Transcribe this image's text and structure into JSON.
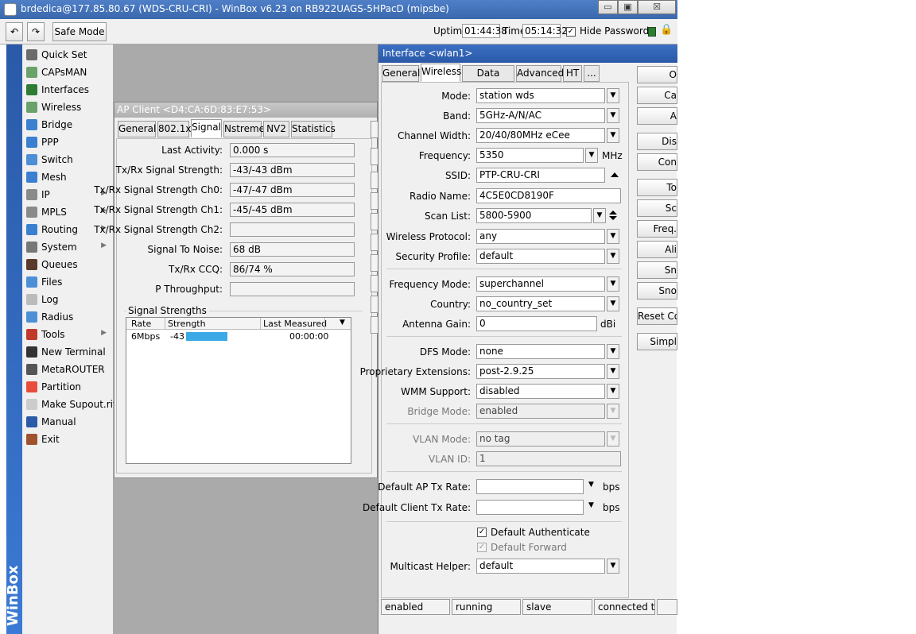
{
  "window": {
    "title": "brdedica@177.85.80.67 (WDS-CRU-CRI) - WinBox v6.23 on RB922UAGS-5HPacD (mipsbe)",
    "minimize_glyph": "▭",
    "maximize_glyph": "▣",
    "close_glyph": "☒"
  },
  "toolbar": {
    "undo_glyph": "↶",
    "redo_glyph": "↷",
    "safe_mode": "Safe Mode",
    "uptime_label": "Uptime:",
    "uptime": "01:44:38",
    "time_label": "Time:",
    "time": "05:14:32",
    "hide_passwords_check": "✓",
    "hide_passwords": "Hide Passwords",
    "lock_glyph": "🔒"
  },
  "brand": "WinBox",
  "sidebar": {
    "items": [
      {
        "label": "Quick Set",
        "icon": "wand-icon",
        "color": "#6b6b6b",
        "arrow": ""
      },
      {
        "label": "CAPsMAN",
        "icon": "antenna-icon",
        "color": "#6aa36a",
        "arrow": ""
      },
      {
        "label": "Interfaces",
        "icon": "interfaces-icon",
        "color": "#2e7d32",
        "arrow": ""
      },
      {
        "label": "Wireless",
        "icon": "wireless-icon",
        "color": "#6aa36a",
        "arrow": ""
      },
      {
        "label": "Bridge",
        "icon": "bridge-icon",
        "color": "#3a7fd0",
        "arrow": ""
      },
      {
        "label": "PPP",
        "icon": "ppp-icon",
        "color": "#3a7fd0",
        "arrow": ""
      },
      {
        "label": "Switch",
        "icon": "switch-icon",
        "color": "#4c8fd6",
        "arrow": ""
      },
      {
        "label": "Mesh",
        "icon": "mesh-icon",
        "color": "#3a7fd0",
        "arrow": ""
      },
      {
        "label": "IP",
        "icon": "ip-icon",
        "color": "#8a8a8a",
        "arrow": "▶"
      },
      {
        "label": "MPLS",
        "icon": "mpls-icon",
        "color": "#8a8a8a",
        "arrow": "▶"
      },
      {
        "label": "Routing",
        "icon": "routing-icon",
        "color": "#3a7fd0",
        "arrow": "▶"
      },
      {
        "label": "System",
        "icon": "gear-icon",
        "color": "#777777",
        "arrow": "▶"
      },
      {
        "label": "Queues",
        "icon": "queues-icon",
        "color": "#5a3a2a",
        "arrow": ""
      },
      {
        "label": "Files",
        "icon": "folder-icon",
        "color": "#4c8fd6",
        "arrow": ""
      },
      {
        "label": "Log",
        "icon": "log-icon",
        "color": "#bbbbbb",
        "arrow": ""
      },
      {
        "label": "Radius",
        "icon": "radius-icon",
        "color": "#4c8fd6",
        "arrow": ""
      },
      {
        "label": "Tools",
        "icon": "tools-icon",
        "color": "#c0392b",
        "arrow": "▶"
      },
      {
        "label": "New Terminal",
        "icon": "terminal-icon",
        "color": "#333333",
        "arrow": ""
      },
      {
        "label": "MetaROUTER",
        "icon": "metarouter-icon",
        "color": "#555555",
        "arrow": ""
      },
      {
        "label": "Partition",
        "icon": "partition-icon",
        "color": "#e74c3c",
        "arrow": ""
      },
      {
        "label": "Make Supout.rif",
        "icon": "document-icon",
        "color": "#cccccc",
        "arrow": ""
      },
      {
        "label": "Manual",
        "icon": "help-icon",
        "color": "#2a5aa8",
        "arrow": ""
      },
      {
        "label": "Exit",
        "icon": "exit-icon",
        "color": "#a0522d",
        "arrow": ""
      }
    ]
  },
  "ap_client": {
    "title": "AP Client <D4:CA:6D:83:E7:53>",
    "tabs": [
      "General",
      "802.1x",
      "Signal",
      "Nstreme",
      "NV2",
      "Statistics"
    ],
    "fields": [
      {
        "label": "Last Activity:",
        "value": "0.000 s"
      },
      {
        "label": "Tx/Rx Signal Strength:",
        "value": "-43/-43 dBm"
      },
      {
        "label": "Tx/Rx Signal Strength Ch0:",
        "value": "-47/-47 dBm"
      },
      {
        "label": "Tx/Rx Signal Strength Ch1:",
        "value": "-45/-45 dBm"
      },
      {
        "label": "Tx/Rx Signal Strength Ch2:",
        "value": ""
      },
      {
        "label": "Signal To Noise:",
        "value": "68 dB"
      },
      {
        "label": "Tx/Rx CCQ:",
        "value": "86/74 %"
      },
      {
        "label": "P Throughput:",
        "value": ""
      }
    ],
    "signal_group": "Signal Strengths",
    "table": {
      "columns": [
        "Rate",
        "Strength",
        "Last Measured"
      ],
      "rows": [
        {
          "rate": "6Mbps",
          "strength": "-43",
          "strength_level": 0.8,
          "last": "00:00:00"
        }
      ]
    }
  },
  "interface": {
    "title": "Interface <wlan1>",
    "tabs": [
      "General",
      "Wireless",
      "Data Rates",
      "Advanced",
      "HT",
      "..."
    ],
    "dropdown_glyph": "▼",
    "mode_label": "Mode:",
    "mode": "station wds",
    "band_label": "Band:",
    "band": "5GHz-A/N/AC",
    "channel_width_label": "Channel Width:",
    "channel_width": "20/40/80MHz eCee",
    "frequency_label": "Frequency:",
    "frequency": "5350",
    "frequency_unit": "MHz",
    "ssid_label": "SSID:",
    "ssid": "PTP-CRU-CRI",
    "radio_name_label": "Radio Name:",
    "radio_name": "4C5E0CD8190F",
    "scan_list_label": "Scan List:",
    "scan_list": "5800-5900",
    "wireless_protocol_label": "Wireless Protocol:",
    "wireless_protocol": "any",
    "security_profile_label": "Security Profile:",
    "security_profile": "default",
    "frequency_mode_label": "Frequency Mode:",
    "frequency_mode": "superchannel",
    "country_label": "Country:",
    "country": "no_country_set",
    "antenna_gain_label": "Antenna Gain:",
    "antenna_gain": "0",
    "antenna_gain_unit": "dBi",
    "dfs_mode_label": "DFS Mode:",
    "dfs_mode": "none",
    "prop_ext_label": "Proprietary Extensions:",
    "prop_ext": "post-2.9.25",
    "wmm_label": "WMM Support:",
    "wmm": "disabled",
    "bridge_mode_label": "Bridge Mode:",
    "bridge_mode": "enabled",
    "vlan_mode_label": "VLAN Mode:",
    "vlan_mode": "no tag",
    "vlan_id_label": "VLAN ID:",
    "vlan_id": "1",
    "ap_tx_label": "Default AP Tx Rate:",
    "ap_tx": "",
    "ap_tx_unit": "bps",
    "client_tx_label": "Default Client Tx Rate:",
    "client_tx": "",
    "client_tx_unit": "bps",
    "default_auth_check": "✓",
    "default_auth_label": "Default Authenticate",
    "default_fwd_check": "✓",
    "default_fwd_label": "Default Forward",
    "multicast_label": "Multicast Helper:",
    "multicast": "default",
    "buttons": [
      "O",
      "Ca",
      "A",
      "Dis",
      "Con",
      "To",
      "Sc",
      "Freq.",
      "Ali",
      "Sn",
      "Sno",
      "Reset Co",
      "Simpl"
    ],
    "status": [
      "enabled",
      "running",
      "slave",
      "connected t..."
    ]
  }
}
